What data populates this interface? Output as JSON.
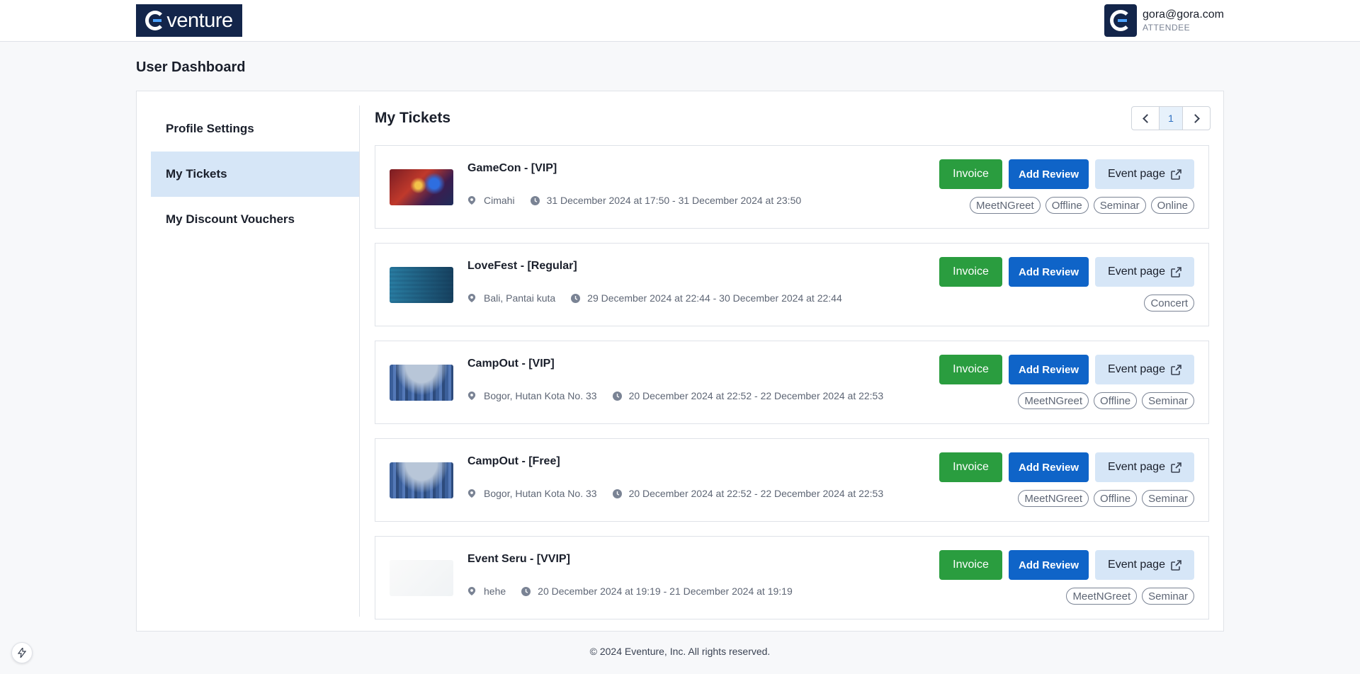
{
  "header": {
    "logo_text": "venture",
    "user_email": "gora@gora.com",
    "user_role": "ATTENDEE"
  },
  "page_title": "User Dashboard",
  "sidebar": {
    "items": [
      {
        "label": "Profile Settings",
        "active": false
      },
      {
        "label": "My Tickets",
        "active": true
      },
      {
        "label": "My Discount Vouchers",
        "active": false
      }
    ]
  },
  "content": {
    "title": "My Tickets",
    "pagination": {
      "current_page": "1"
    }
  },
  "buttons": {
    "invoice": "Invoice",
    "add_review": "Add Review",
    "event_page": "Event page"
  },
  "tickets": [
    {
      "title": "GameCon - [VIP]",
      "location": "Cimahi",
      "datetime": "31 December 2024 at 17:50 - 31 December 2024 at 23:50",
      "tags": [
        "MeetNGreet",
        "Offline",
        "Seminar",
        "Online"
      ],
      "thumb": "gamecon"
    },
    {
      "title": "LoveFest - [Regular]",
      "location": "Bali, Pantai kuta",
      "datetime": "29 December 2024 at 22:44 - 30 December 2024 at 22:44",
      "tags": [
        "Concert"
      ],
      "thumb": "lovefest"
    },
    {
      "title": "CampOut - [VIP]",
      "location": "Bogor, Hutan Kota No. 33",
      "datetime": "20 December 2024 at 22:52 - 22 December 2024 at 22:53",
      "tags": [
        "MeetNGreet",
        "Offline",
        "Seminar"
      ],
      "thumb": "campout"
    },
    {
      "title": "CampOut - [Free]",
      "location": "Bogor, Hutan Kota No. 33",
      "datetime": "20 December 2024 at 22:52 - 22 December 2024 at 22:53",
      "tags": [
        "MeetNGreet",
        "Offline",
        "Seminar"
      ],
      "thumb": "campout"
    },
    {
      "title": "Event Seru - [VVIP]",
      "location": "hehe",
      "datetime": "20 December 2024 at 19:19 - 21 December 2024 at 19:19",
      "tags": [
        "MeetNGreet",
        "Seminar"
      ],
      "thumb": "seru"
    }
  ],
  "footer": "© 2024 Eventure, Inc. All rights reserved.",
  "colors": {
    "brand_navy": "#13254a",
    "invoice_green": "#2a9d3f",
    "review_blue": "#0f64c8",
    "active_tab_bg": "#d6e6f7"
  }
}
